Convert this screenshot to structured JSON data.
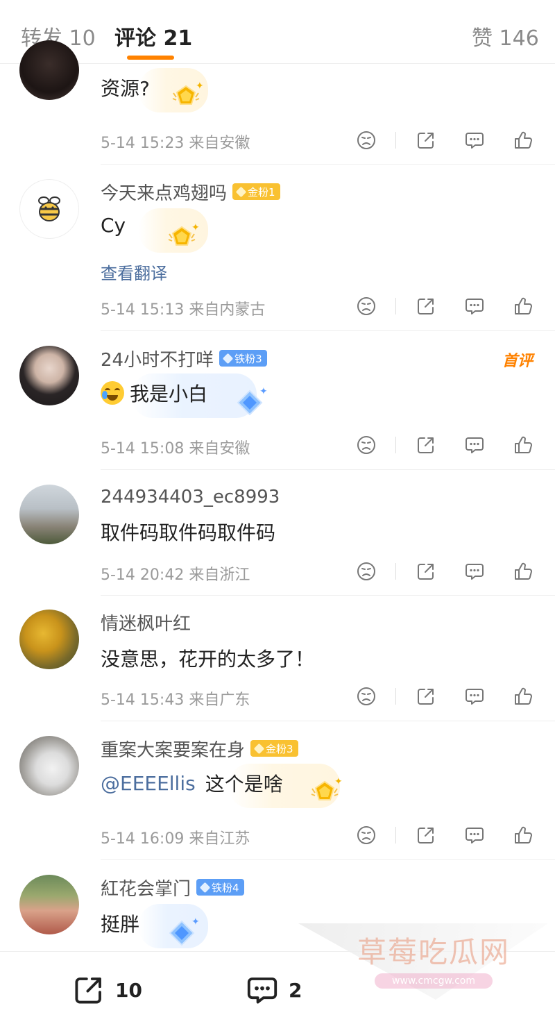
{
  "tabs": {
    "repost": "转发 10",
    "comments": "评论 21",
    "likes": "赞 146"
  },
  "comments": [
    {
      "name": "",
      "text": "资源?",
      "meta": "5-14 15:23 来自安徽"
    },
    {
      "name": "今天来点鸡翅吗",
      "badge": "金粉1",
      "text": "Cy",
      "translate": "查看翻译",
      "meta": "5-14 15:13 来自内蒙古"
    },
    {
      "name": "24小时不打咩",
      "badge": "铁粉3",
      "first": "首评",
      "text": "我是小白",
      "meta": "5-14 15:08 来自安徽"
    },
    {
      "name": "244934403_ec8993",
      "text": "取件码取件码取件码",
      "meta": "5-14 20:42 来自浙江"
    },
    {
      "name": "情迷枫叶红",
      "text": "没意思，花开的太多了！",
      "meta": "5-14 15:43 来自广东"
    },
    {
      "name": "重案大案要案在身",
      "badge": "金粉3",
      "mention": "@EEEEllis",
      "text": "这个是啥",
      "meta": "5-14 16:09 来自江苏"
    },
    {
      "name": "紅花会掌门",
      "badge": "铁粉4",
      "text": "挺胖"
    }
  ],
  "bottom_bar": {
    "repost_count": "10",
    "comment_count": "2"
  },
  "watermark": {
    "title": "草莓吃瓜网",
    "url": "www.cmcgw.com"
  },
  "icons": [
    "dislike-icon",
    "share-icon",
    "comment-icon",
    "like-icon",
    "bee-icon",
    "crying-laugh-emoji",
    "gold-medal-icon",
    "diamond-icon"
  ],
  "colors": {
    "accent": "#ff8200",
    "link": "#4c6e9e",
    "gold_badge": "#f9c131",
    "iron_badge": "#5c9ef6"
  }
}
